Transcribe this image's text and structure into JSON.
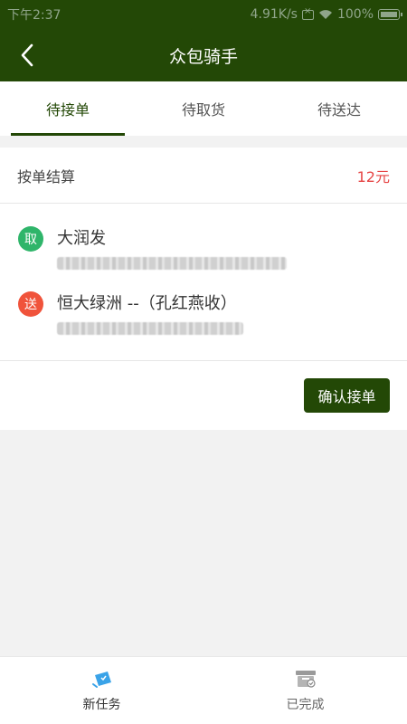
{
  "statusbar": {
    "time": "下午2:37",
    "speed": "4.91K/s",
    "battery": "100%"
  },
  "header": {
    "title": "众包骑手",
    "back_icon": "chevron-left-icon"
  },
  "tabs": [
    {
      "label": "待接单",
      "active": true
    },
    {
      "label": "待取货",
      "active": false
    },
    {
      "label": "待送达",
      "active": false
    }
  ],
  "order": {
    "settle_label": "按单结算",
    "price": "12元",
    "pickup": {
      "badge": "取",
      "name": "大润发",
      "badge_color": "#2fb56a"
    },
    "dropoff": {
      "badge": "送",
      "name": "恒大绿洲 --（孔红燕收）",
      "badge_color": "#f0533b"
    },
    "confirm_label": "确认接单"
  },
  "bottom_nav": [
    {
      "label": "新任务",
      "icon": "new-task-icon",
      "active": true
    },
    {
      "label": "已完成",
      "icon": "completed-box-icon",
      "active": false
    }
  ],
  "colors": {
    "brand": "#234806",
    "price": "#e64545",
    "nav_icon_active": "#3aa3e8"
  }
}
